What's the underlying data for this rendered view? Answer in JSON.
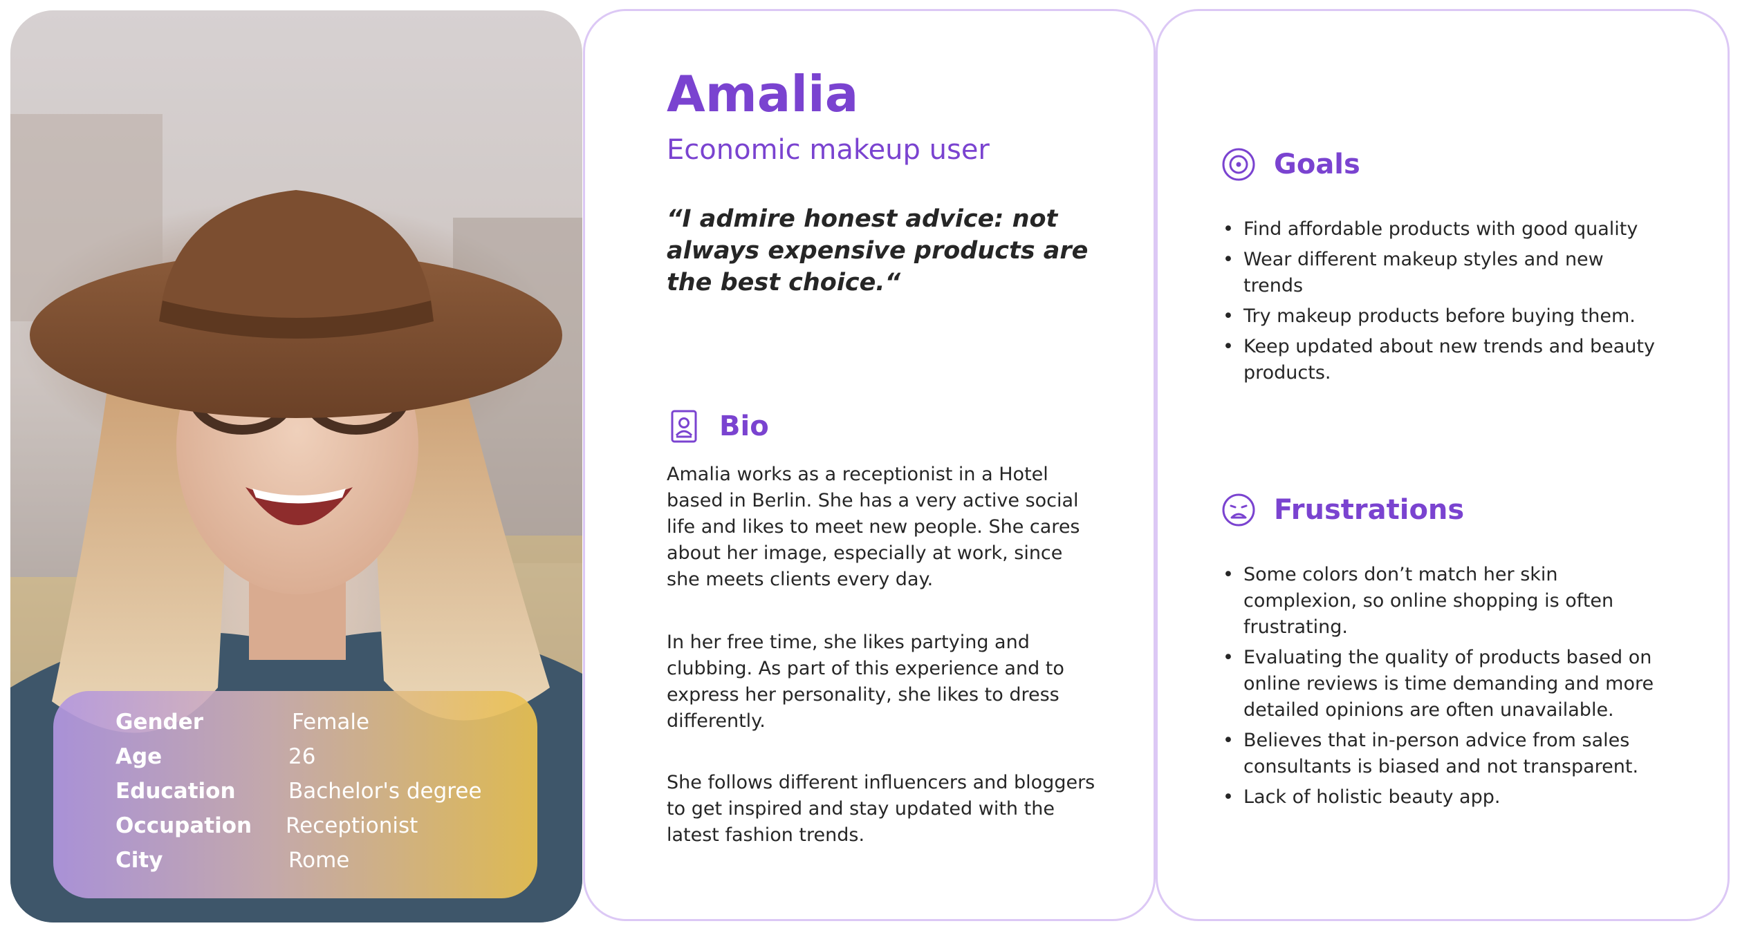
{
  "persona": {
    "name": "Amalia",
    "role": "Economic makeup user",
    "quote": "“I admire honest advice: not always expensive products are the best choice.“"
  },
  "info": [
    {
      "label": "Gender",
      "value": "Female"
    },
    {
      "label": "Age",
      "value": "26"
    },
    {
      "label": "Education",
      "value": "Bachelor's degree"
    },
    {
      "label": "Occupation",
      "value": "Receptionist"
    },
    {
      "label": "City",
      "value": "Rome"
    }
  ],
  "bio": {
    "title": "Bio",
    "icon": "profile-card-icon",
    "paragraphs": [
      "Amalia works as a receptionist in a Hotel based in Berlin. She has a very active social life and likes to meet new people. She cares about her image, especially at work, since she meets clients every day.",
      " In her free time, she likes partying and clubbing. As part of this experience and to express her personality, she likes to dress differently.",
      "She follows different influencers and bloggers to get inspired and stay updated with the latest fashion trends."
    ]
  },
  "goals": {
    "title": "Goals",
    "icon": "target-icon",
    "items": [
      "Find affordable products with good quality",
      "Wear different makeup styles and new trends",
      "Try makeup products before buying them.",
      "Keep updated about new trends and beauty products."
    ]
  },
  "frustrations": {
    "title": "Frustrations",
    "icon": "sad-face-icon",
    "items": [
      "Some colors don’t match her skin complexion, so online shopping is often frustrating.",
      "Evaluating the quality of products based on online reviews is time demanding and more detailed opinions are often unavailable.",
      "Believes that in-person advice from sales consultants is biased and not transparent.",
      "Lack of holistic beauty app."
    ]
  },
  "colors": {
    "accent": "#7a43d0",
    "card_border": "#dcc8f5",
    "text": "#262626"
  }
}
